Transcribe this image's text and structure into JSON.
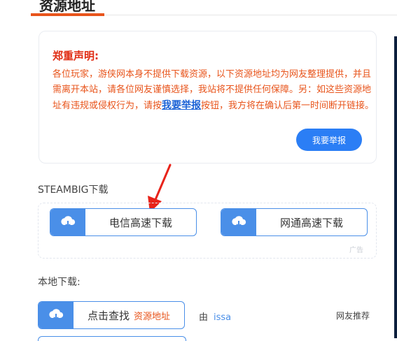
{
  "header": {
    "section_title": "资源地址"
  },
  "notice": {
    "title": "郑重声明:",
    "body_before_link": "各位玩家，游侠网本身不提供下载资源，以下资源地址均为网友整理提供，并且需离开本站，请各位网友谨慎选择，我站将不提供任何保障。另：如这些资源地址有违规或侵权行为，请按",
    "link_text": "我要举报",
    "body_after_link": "按钮，我方将在确认后第一时间断开链接。",
    "report_button": "我要举报"
  },
  "steam": {
    "label": "STEAMBIG下载",
    "buttons": [
      {
        "label": "电信高速下载",
        "icon": "cloud-download-icon"
      },
      {
        "label": "网通高速下载",
        "icon": "cloud-download-icon"
      }
    ],
    "ad_label": "广告"
  },
  "local": {
    "label": "本地下载:",
    "button": {
      "label": "点击查找",
      "tag": "资源地址",
      "icon": "cloud-download-icon"
    },
    "by_prefix": "由",
    "user": "issa",
    "recommend": "网友推荐"
  },
  "colors": {
    "accent": "#4a8fe8",
    "warning": "#e8541b",
    "title_red": "#e02c13",
    "report_button": "#2b7ef5",
    "annotation_arrow": "#e8231a"
  }
}
